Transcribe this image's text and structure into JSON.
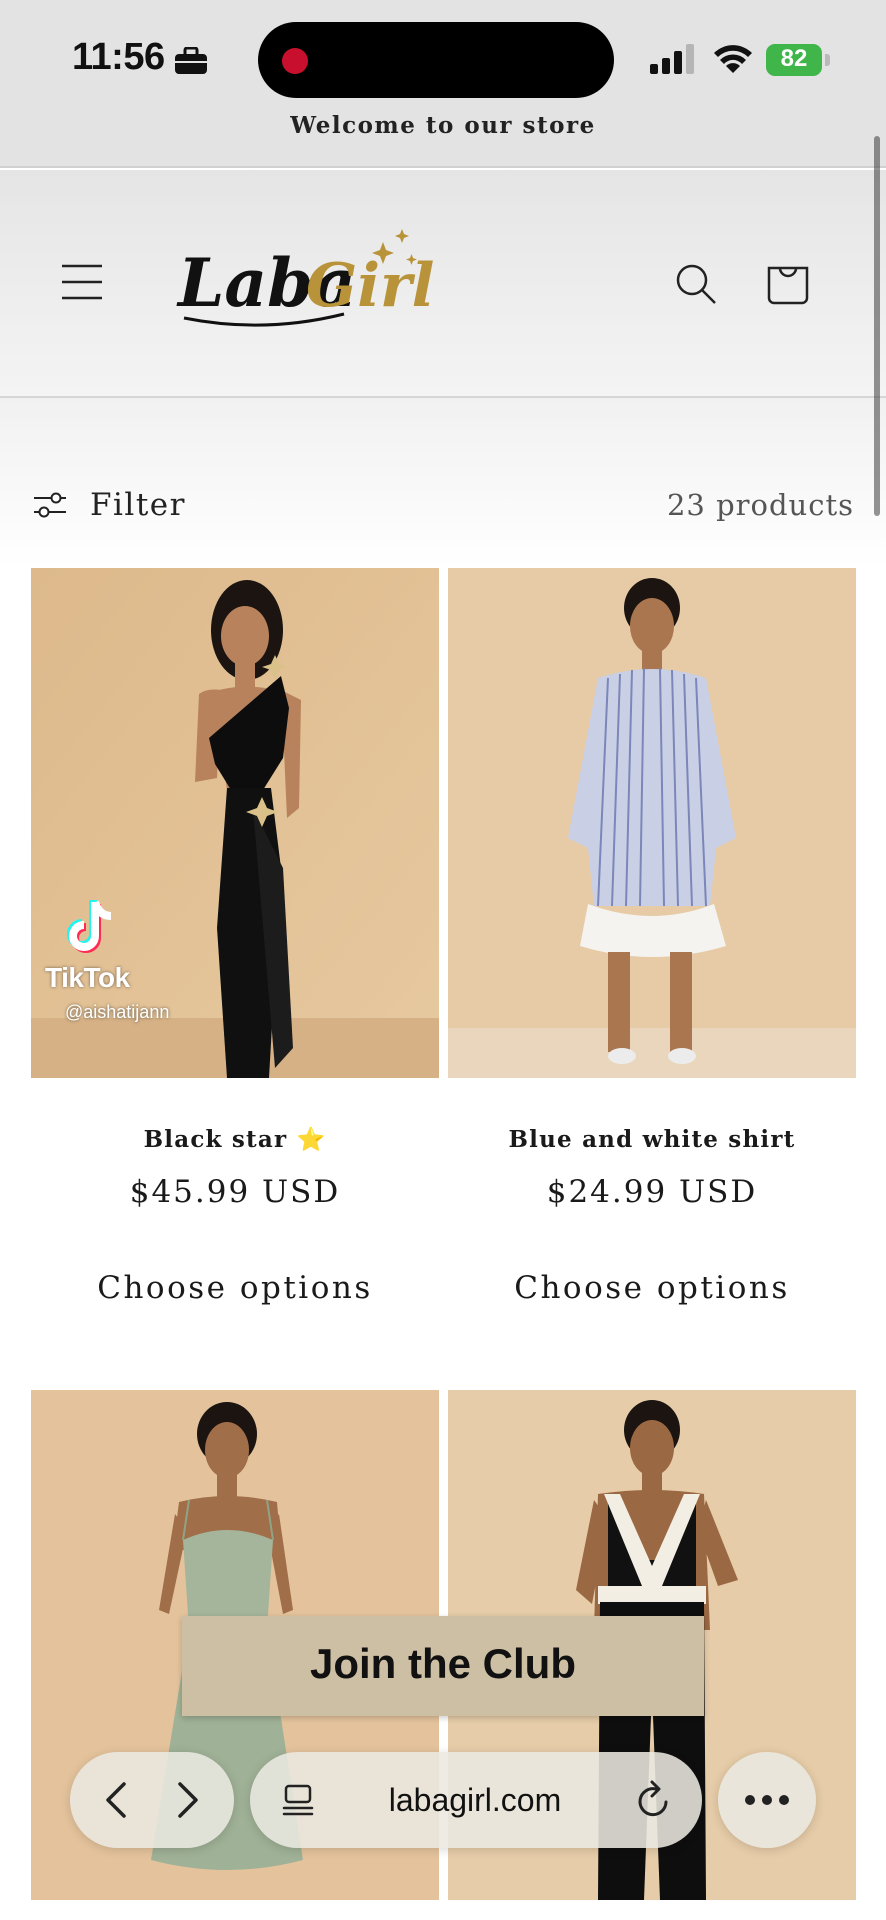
{
  "status_bar": {
    "time": "11:56",
    "battery": "82"
  },
  "announcement": {
    "text": "Welcome to our store"
  },
  "header": {
    "logo_text": "LabaGirl"
  },
  "filter": {
    "label": "Filter",
    "count": "23 products"
  },
  "products": [
    {
      "title": "Black star ⭐️",
      "price": "$45.99 USD",
      "button": "Choose options"
    },
    {
      "title": "Blue and white shirt",
      "price": "$24.99 USD",
      "button": "Choose options"
    },
    {
      "title": "",
      "price": "",
      "button": ""
    },
    {
      "title": "",
      "price": "",
      "button": ""
    }
  ],
  "watermark": {
    "brand": "TikTok",
    "handle": "@aishatijann"
  },
  "join": {
    "text": "Join the Club"
  },
  "browser": {
    "url": "labagirl.com"
  },
  "colors": {
    "accent_gold": "#b8933a",
    "battery_green": "#3fb54a",
    "banner": "#cdbfa3",
    "image_bg": "#e2c8a4"
  }
}
